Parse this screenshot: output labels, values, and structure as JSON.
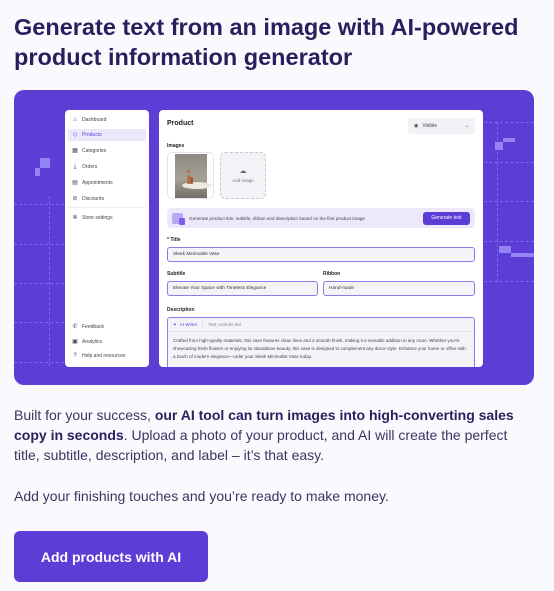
{
  "heading": "Generate text from an image with AI-powered product information generator",
  "colors": {
    "accent": "#5c3dd6",
    "heading": "#2a1f5c",
    "background": "#f9f9fe"
  },
  "mockup": {
    "sidebar": {
      "items": [
        {
          "label": "Dashboard",
          "icon": "home-icon",
          "active": false
        },
        {
          "label": "Products",
          "icon": "tag-icon",
          "active": true
        },
        {
          "label": "Categories",
          "icon": "grid-icon",
          "active": false
        },
        {
          "label": "Orders",
          "icon": "download-icon",
          "active": false
        },
        {
          "label": "Appointments",
          "icon": "calendar-icon",
          "active": false
        },
        {
          "label": "Discounts",
          "icon": "discount-icon",
          "active": false
        },
        {
          "label": "Store settings",
          "icon": "gear-icon",
          "active": false
        }
      ],
      "bottom_items": [
        {
          "label": "Feedback",
          "icon": "feedback-icon"
        },
        {
          "label": "Analytics",
          "icon": "analytics-icon"
        },
        {
          "label": "Help and resources",
          "icon": "help-icon"
        }
      ]
    },
    "panel": {
      "title": "Product",
      "visibility": "Visible",
      "images_label": "Images",
      "add_image_label": "Add image",
      "ai_banner_text": "Generate product title, subtitle, ribbon and description based on the first product image",
      "generate_button": "Generate text",
      "title_label": "* Title",
      "title_value": "Sleek Minimalist Vase",
      "subtitle_label": "Subtitle",
      "subtitle_value": "Elevate Your Space with Timeless Elegance",
      "ribbon_label": "Ribbon",
      "ribbon_value": "Hand-made",
      "description_label": "Description",
      "ai_writer_label": "AI Writer",
      "text_controls_label": "Text controls bar",
      "description_value": "Crafted from high-quality materials, this vase features clean lines and a smooth finish, making it a versatile addition to any room. Whether you're showcasing fresh flowers or enjoying its standalone beauty, this vase is designed to complement any decor style. Enhance your home or office with a touch of modern elegance—order your Sleek Minimalist Vase today."
    }
  },
  "body": {
    "intro": "Built for your success, ",
    "bold": "our AI tool can turn images into high-converting sales copy in seconds",
    "rest": ". Upload a photo of your product, and AI will create the perfect title, subtitle, description, and label – it’s that easy.",
    "second": "Add your finishing touches and you’re ready to make money."
  },
  "cta_label": "Add products with AI"
}
